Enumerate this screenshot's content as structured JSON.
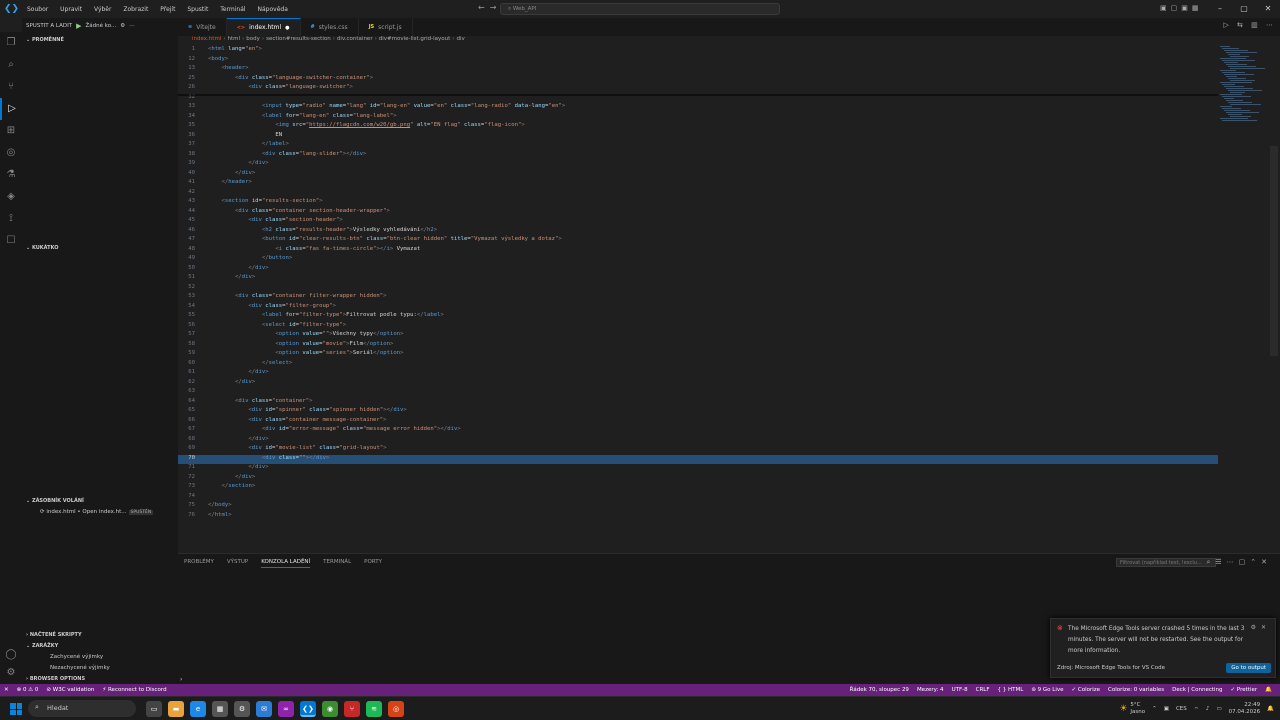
{
  "titlebar": {
    "menu": [
      "Soubor",
      "Upravit",
      "Výběr",
      "Zobrazit",
      "Přejít",
      "Spustit",
      "Terminál",
      "Nápověda"
    ],
    "search": "Web_API"
  },
  "sidebar": {
    "run_label": "SPUSTIT A LADIT",
    "config": "Žádné ko...",
    "sections": {
      "variables": "PROMĚNNÉ",
      "watch": "KUKÁTKO",
      "callstack": "ZÁSOBNÍK VOLÁNÍ",
      "loaded": "NAČTENÉ SKRIPTY",
      "breakpoints": "ZARÁŽKY",
      "browser": "BROWSER OPTIONS"
    },
    "callstack_item": "index.html • Open index.ht...",
    "callstack_tag": "SPUŠTĚN",
    "breakpoints": [
      "Zachycené výjimky",
      "Nezachycené výjimky"
    ]
  },
  "tabs": [
    {
      "label": "Vítejte",
      "icon": "≡",
      "color": "#3b9fe7",
      "active": false
    },
    {
      "label": "index.html",
      "icon": "<>",
      "color": "#e44d26",
      "active": true,
      "dirty": "●"
    },
    {
      "label": "styles.css",
      "icon": "#",
      "color": "#42a5f5",
      "active": false
    },
    {
      "label": "script.js",
      "icon": "JS",
      "color": "#f5de19",
      "active": false
    }
  ],
  "breadcrumb": [
    "index.html",
    "html",
    "body",
    "section#results-section",
    "div.container",
    "div#movie-list.grid-layout",
    "div"
  ],
  "code": [
    {
      "n": "1",
      "html": "<span class=\"p\">&lt;</span><span class=\"t\">html</span> <span class=\"a\">lang</span><span class=\"x\">=</span><span class=\"s\">\"en\"</span><span class=\"p\">&gt;</span>"
    },
    {
      "n": "12",
      "html": "<span class=\"p\">&lt;</span><span class=\"t\">body</span><span class=\"p\">&gt;</span>"
    },
    {
      "n": "13",
      "html": "    <span class=\"p\">&lt;</span><span class=\"t\">header</span><span class=\"p\">&gt;</span>"
    },
    {
      "n": "25",
      "html": "        <span class=\"p\">&lt;</span><span class=\"t\">div</span> <span class=\"a\">class</span><span class=\"x\">=</span><span class=\"s\">\"language-switcher-container\"</span><span class=\"p\">&gt;</span>"
    },
    {
      "n": "26",
      "html": "            <span class=\"p\">&lt;</span><span class=\"t\">div</span> <span class=\"a\">class</span><span class=\"x\">=</span><span class=\"s\">\"language-switcher\"</span><span class=\"p\">&gt;</span>"
    },
    {
      "n": "32",
      "html": ""
    },
    {
      "n": "33",
      "html": "                <span class=\"p\">&lt;</span><span class=\"t\">input</span> <span class=\"a\">type</span><span class=\"x\">=</span><span class=\"s\">\"radio\"</span> <span class=\"a\">name</span><span class=\"x\">=</span><span class=\"s\">\"lang\"</span> <span class=\"a\">id</span><span class=\"x\">=</span><span class=\"s\">\"lang-en\"</span> <span class=\"a\">value</span><span class=\"x\">=</span><span class=\"s\">\"en\"</span> <span class=\"a\">class</span><span class=\"x\">=</span><span class=\"s\">\"lang-radio\"</span> <span class=\"a\">data-lang</span><span class=\"x\">=</span><span class=\"s\">\"en\"</span><span class=\"p\">&gt;</span>"
    },
    {
      "n": "34",
      "html": "                <span class=\"p\">&lt;</span><span class=\"t\">label</span> <span class=\"a\">for</span><span class=\"x\">=</span><span class=\"s\">\"lang-en\"</span> <span class=\"a\">class</span><span class=\"x\">=</span><span class=\"s\">\"lang-label\"</span><span class=\"p\">&gt;</span>"
    },
    {
      "n": "35",
      "html": "                    <span class=\"p\">&lt;</span><span class=\"t\">img</span> <span class=\"a\">src</span><span class=\"x\">=</span><span class=\"s\">\"</span><span class=\"u\">https://flagcdn.com/w20/gb.png</span><span class=\"s\">\"</span> <span class=\"a\">alt</span><span class=\"x\">=</span><span class=\"s\">\"EN flag\"</span> <span class=\"a\">class</span><span class=\"x\">=</span><span class=\"s\">\"flag-icon\"</span><span class=\"p\">&gt;</span>"
    },
    {
      "n": "36",
      "html": "                    <span class=\"x\">EN</span>"
    },
    {
      "n": "37",
      "html": "                <span class=\"p\">&lt;/</span><span class=\"t\">label</span><span class=\"p\">&gt;</span>"
    },
    {
      "n": "38",
      "html": "                <span class=\"p\">&lt;</span><span class=\"t\">div</span> <span class=\"a\">class</span><span class=\"x\">=</span><span class=\"s\">\"lang-slider\"</span><span class=\"p\">&gt;&lt;/</span><span class=\"t\">div</span><span class=\"p\">&gt;</span>"
    },
    {
      "n": "39",
      "html": "            <span class=\"p\">&lt;/</span><span class=\"t\">div</span><span class=\"p\">&gt;</span>"
    },
    {
      "n": "40",
      "html": "        <span class=\"p\">&lt;/</span><span class=\"t\">div</span><span class=\"p\">&gt;</span>"
    },
    {
      "n": "41",
      "html": "    <span class=\"p\">&lt;/</span><span class=\"t\">header</span><span class=\"p\">&gt;</span>"
    },
    {
      "n": "42",
      "html": ""
    },
    {
      "n": "43",
      "html": "    <span class=\"p\">&lt;</span><span class=\"t\">section</span> <span class=\"a\">id</span><span class=\"x\">=</span><span class=\"s\">\"results-section\"</span><span class=\"p\">&gt;</span>"
    },
    {
      "n": "44",
      "html": "        <span class=\"p\">&lt;</span><span class=\"t\">div</span> <span class=\"a\">class</span><span class=\"x\">=</span><span class=\"s\">\"container section-header-wrapper\"</span><span class=\"p\">&gt;</span>"
    },
    {
      "n": "45",
      "html": "            <span class=\"p\">&lt;</span><span class=\"t\">div</span> <span class=\"a\">class</span><span class=\"x\">=</span><span class=\"s\">\"section-header\"</span><span class=\"p\">&gt;</span>"
    },
    {
      "n": "46",
      "html": "                <span class=\"p\">&lt;</span><span class=\"t\">h2</span> <span class=\"a\">class</span><span class=\"x\">=</span><span class=\"s\">\"results-header\"</span><span class=\"p\">&gt;</span><span class=\"x\">Výsledky vyhledávání</span><span class=\"p\">&lt;/</span><span class=\"t\">h2</span><span class=\"p\">&gt;</span>"
    },
    {
      "n": "47",
      "html": "                <span class=\"p\">&lt;</span><span class=\"t\">button</span> <span class=\"a\">id</span><span class=\"x\">=</span><span class=\"s\">\"clear-results-btn\"</span> <span class=\"a\">class</span><span class=\"x\">=</span><span class=\"s\">\"btn-clear hidden\"</span> <span class=\"a\">title</span><span class=\"x\">=</span><span class=\"s\">\"Vymazat výsledky a dotaz\"</span><span class=\"p\">&gt;</span>"
    },
    {
      "n": "48",
      "html": "                    <span class=\"p\">&lt;</span><span class=\"t\">i</span> <span class=\"a\">class</span><span class=\"x\">=</span><span class=\"s\">\"fas fa-times-circle\"</span><span class=\"p\">&gt;&lt;/</span><span class=\"t\">i</span><span class=\"p\">&gt;</span><span class=\"x\"> Vymazat</span>"
    },
    {
      "n": "49",
      "html": "                <span class=\"p\">&lt;/</span><span class=\"t\">button</span><span class=\"p\">&gt;</span>"
    },
    {
      "n": "50",
      "html": "            <span class=\"p\">&lt;/</span><span class=\"t\">div</span><span class=\"p\">&gt;</span>"
    },
    {
      "n": "51",
      "html": "        <span class=\"p\">&lt;/</span><span class=\"t\">div</span><span class=\"p\">&gt;</span>"
    },
    {
      "n": "52",
      "html": ""
    },
    {
      "n": "53",
      "html": "        <span class=\"p\">&lt;</span><span class=\"t\">div</span> <span class=\"a\">class</span><span class=\"x\">=</span><span class=\"s\">\"container filter-wrapper hidden\"</span><span class=\"p\">&gt;</span>"
    },
    {
      "n": "54",
      "html": "            <span class=\"p\">&lt;</span><span class=\"t\">div</span> <span class=\"a\">class</span><span class=\"x\">=</span><span class=\"s\">\"filter-group\"</span><span class=\"p\">&gt;</span>"
    },
    {
      "n": "55",
      "html": "                <span class=\"p\">&lt;</span><span class=\"t\">label</span> <span class=\"a\">for</span><span class=\"x\">=</span><span class=\"s\">\"filter-type\"</span><span class=\"p\">&gt;</span><span class=\"x\">Filtrovat podle typu:</span><span class=\"p\">&lt;/</span><span class=\"t\">label</span><span class=\"p\">&gt;</span>"
    },
    {
      "n": "56",
      "html": "                <span class=\"p\">&lt;</span><span class=\"t\">select</span> <span class=\"a\">id</span><span class=\"x\">=</span><span class=\"s\">\"filter-type\"</span><span class=\"p\">&gt;</span>"
    },
    {
      "n": "57",
      "html": "                    <span class=\"p\">&lt;</span><span class=\"t\">option</span> <span class=\"a\">value</span><span class=\"x\">=</span><span class=\"s\">\"\"</span><span class=\"p\">&gt;</span><span class=\"x\">Všechny typy</span><span class=\"p\">&lt;/</span><span class=\"t\">option</span><span class=\"p\">&gt;</span>"
    },
    {
      "n": "58",
      "html": "                    <span class=\"p\">&lt;</span><span class=\"t\">option</span> <span class=\"a\">value</span><span class=\"x\">=</span><span class=\"s\">\"movie\"</span><span class=\"p\">&gt;</span><span class=\"x\">Film</span><span class=\"p\">&lt;/</span><span class=\"t\">option</span><span class=\"p\">&gt;</span>"
    },
    {
      "n": "59",
      "html": "                    <span class=\"p\">&lt;</span><span class=\"t\">option</span> <span class=\"a\">value</span><span class=\"x\">=</span><span class=\"s\">\"series\"</span><span class=\"p\">&gt;</span><span class=\"x\">Seriál</span><span class=\"p\">&lt;/</span><span class=\"t\">option</span><span class=\"p\">&gt;</span>"
    },
    {
      "n": "60",
      "html": "                <span class=\"p\">&lt;/</span><span class=\"t\">select</span><span class=\"p\">&gt;</span>"
    },
    {
      "n": "61",
      "html": "            <span class=\"p\">&lt;/</span><span class=\"t\">div</span><span class=\"p\">&gt;</span>"
    },
    {
      "n": "62",
      "html": "        <span class=\"p\">&lt;/</span><span class=\"t\">div</span><span class=\"p\">&gt;</span>"
    },
    {
      "n": "63",
      "html": ""
    },
    {
      "n": "64",
      "html": "        <span class=\"p\">&lt;</span><span class=\"t\">div</span> <span class=\"a\">class</span><span class=\"x\">=</span><span class=\"s\">\"container\"</span><span class=\"p\">&gt;</span>"
    },
    {
      "n": "65",
      "html": "            <span class=\"p\">&lt;</span><span class=\"t\">div</span> <span class=\"a\">id</span><span class=\"x\">=</span><span class=\"s\">\"spinner\"</span> <span class=\"a\">class</span><span class=\"x\">=</span><span class=\"s\">\"spinner hidden\"</span><span class=\"p\">&gt;&lt;/</span><span class=\"t\">div</span><span class=\"p\">&gt;</span>"
    },
    {
      "n": "66",
      "html": "            <span class=\"p\">&lt;</span><span class=\"t\">div</span> <span class=\"a\">class</span><span class=\"x\">=</span><span class=\"s\">\"container message-container\"</span><span class=\"p\">&gt;</span>"
    },
    {
      "n": "67",
      "html": "                <span class=\"p\">&lt;</span><span class=\"t\">div</span> <span class=\"a\">id</span><span class=\"x\">=</span><span class=\"s\">\"error-message\"</span> <span class=\"a\">class</span><span class=\"x\">=</span><span class=\"s\">\"message error hidden\"</span><span class=\"p\">&gt;&lt;/</span><span class=\"t\">div</span><span class=\"p\">&gt;</span>"
    },
    {
      "n": "68",
      "html": "            <span class=\"p\">&lt;/</span><span class=\"t\">div</span><span class=\"p\">&gt;</span>"
    },
    {
      "n": "69",
      "html": "            <span class=\"p\">&lt;</span><span class=\"t\">div</span> <span class=\"a\">id</span><span class=\"x\">=</span><span class=\"s\">\"movie-list\"</span> <span class=\"a\">class</span><span class=\"x\">=</span><span class=\"s\">\"grid-layout\"</span><span class=\"p\">&gt;</span>"
    },
    {
      "n": "70",
      "html": "                <span class=\"p\">&lt;</span><span class=\"t\">div</span> <span class=\"a\">class</span><span class=\"x\">=</span><span class=\"s\">\"\"</span><span class=\"p\">&gt;&lt;/</span><span class=\"t\">div</span><span class=\"p\">&gt;</span>",
      "current": true
    },
    {
      "n": "71",
      "html": "            <span class=\"p\">&lt;/</span><span class=\"t\">div</span><span class=\"p\">&gt;</span>"
    },
    {
      "n": "72",
      "html": "        <span class=\"p\">&lt;/</span><span class=\"t\">div</span><span class=\"p\">&gt;</span>"
    },
    {
      "n": "73",
      "html": "    <span class=\"p\">&lt;/</span><span class=\"t\">section</span><span class=\"p\">&gt;</span>"
    },
    {
      "n": "74",
      "html": ""
    },
    {
      "n": "75",
      "html": "<span class=\"p\">&lt;/</span><span class=\"t\">body</span><span class=\"p\">&gt;</span>"
    },
    {
      "n": "76",
      "html": "<span class=\"p\">&lt;/</span><span class=\"t\">html</span><span class=\"p\">&gt;</span>"
    }
  ],
  "panel": {
    "tabs": [
      "PROBLÉMY",
      "VÝSTUP",
      "KONZOLA LADĚNÍ",
      "TERMINÁL",
      "PORTY"
    ],
    "active_tab": "KONZOLA LADĚNÍ",
    "filter_placeholder": "Filtrovat (například text, !exclu..."
  },
  "toast": {
    "message": "The Microsoft Edge Tools server crashed 5 times in the last 3 minutes. The server will not be restarted. See the output for more information.",
    "source": "Zdroj: Microsoft Edge Tools for VS Code",
    "button": "Go to output"
  },
  "statusbar": {
    "left": [
      "✕",
      "⊗ 0 ⚠ 0",
      "⊘ W3C validation",
      "⚡ Reconnect to Discord"
    ],
    "right": [
      "Řádek 70, sloupec 29",
      "Mezery: 4",
      "UTF-8",
      "CRLF",
      "{ } HTML",
      "⊚ 9 Go Live",
      "✓ Colorize",
      "Colorize: 0 variables",
      "Deck | Connecting",
      "✓ Prettier"
    ]
  },
  "taskbar": {
    "search": "Hledat",
    "weather_temp": "5°C",
    "weather_desc": "Jasno",
    "lang": "CES",
    "time": "22:49",
    "date": "07.04.2026"
  },
  "colors": {
    "accent": "#0078d4",
    "statusbar": "#68217a"
  }
}
